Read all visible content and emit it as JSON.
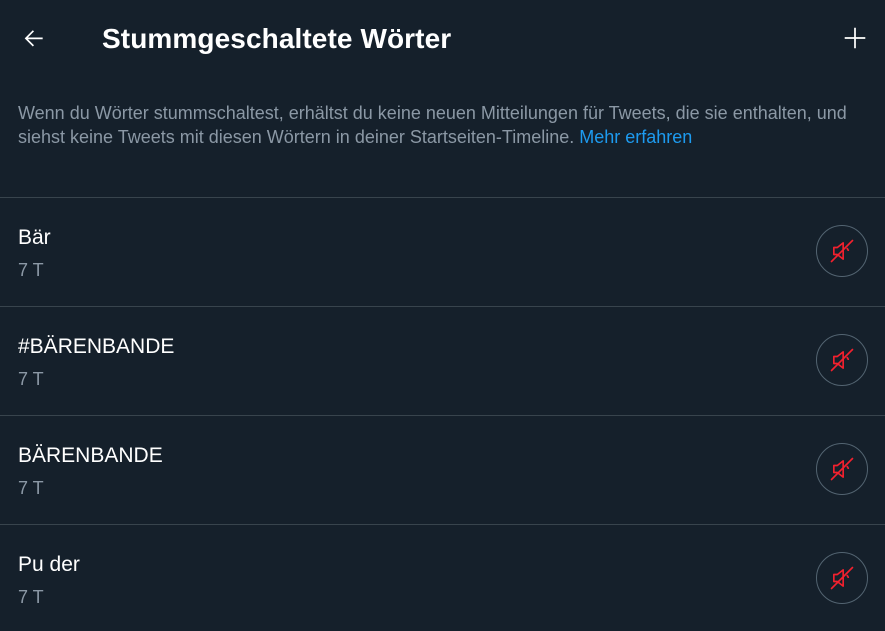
{
  "header": {
    "title": "Stummgeschaltete Wörter",
    "back_icon": "arrow-left-icon",
    "add_icon": "plus-icon"
  },
  "description": {
    "text": "Wenn du Wörter stummschaltest, erhältst du keine neuen Mitteilungen für Tweets, die sie enthalten, und siehst keine Tweets mit diesen Wörtern in deiner Startseiten-Timeline. ",
    "link_text": "Mehr erfahren"
  },
  "muted_words": [
    {
      "word": "Bär",
      "duration": "7 T"
    },
    {
      "word": "#BÄRENBANDE",
      "duration": "7 T"
    },
    {
      "word": "BÄRENBANDE",
      "duration": "7 T"
    },
    {
      "word": "Pu der",
      "duration": "7 T"
    }
  ],
  "colors": {
    "background": "#15202b",
    "text_primary": "#ffffff",
    "text_secondary": "#8b98a5",
    "link": "#1d9bf0",
    "divider": "#38444d",
    "unmute_icon": "#f4212e"
  },
  "icons": {
    "unmute": "speaker-muted-icon"
  }
}
